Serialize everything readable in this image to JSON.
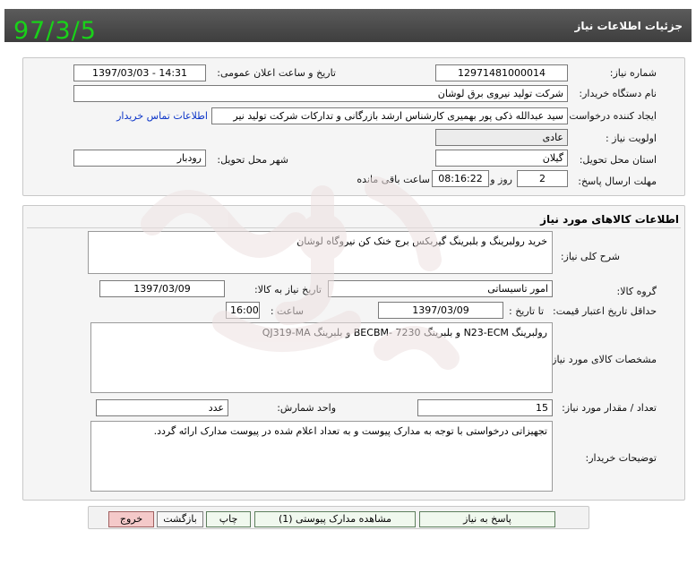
{
  "header": {
    "title": "جزئیات اطلاعات نیاز",
    "date_stamp": "97/3/5"
  },
  "need_info": {
    "need_number_label": "شماره نیاز:",
    "need_number": "12971481000014",
    "announce_label": "تاریخ و ساعت اعلان عمومی:",
    "announce_value": "1397/03/03 - 14:31",
    "buyer_org_label": "نام دستگاه خریدار:",
    "buyer_org": "شرکت تولید نیروی برق لوشان",
    "creator_label": "ایجاد کننده درخواست:",
    "creator": "سید عبدالله ذکی پور بهمیری کارشناس ارشد بازرگانی و تدارکات شرکت تولید نیر",
    "contact_link": "اطلاعات تماس خریدار",
    "priority_label": "اولویت نیاز :",
    "priority": "عادی",
    "province_label": "استان محل تحویل:",
    "province": "گیلان",
    "city_label": "شهر محل تحویل:",
    "city": "رودبار",
    "deadline_label": "مهلت ارسال پاسخ:",
    "days_value": "2",
    "days_word": "روز و",
    "time_value": "08:16:22",
    "remaining_word": "ساعت باقی مانده"
  },
  "goods": {
    "section_title": "اطلاعات کالاهای مورد نیاز",
    "summary_label": "شرح کلی نیاز:",
    "summary": "خرید رولبرینگ و بلبرینگ گیربکس برج خنک کن نیروگاه لوشان",
    "group_label": "گروه کالا:",
    "group": "امور تاسیساتی",
    "need_date_label": "تاریخ نیاز به کالا:",
    "need_date": "1397/03/09",
    "price_valid_label": "حداقل تاریخ اعتبار قیمت:",
    "until_label": "تا تاریخ :",
    "until_date": "1397/03/09",
    "hour_label": "ساعت :",
    "hour": "16:00",
    "specs_label": "مشخصات کالای مورد نیاز:",
    "specs": "رولبرینگ N23-ECM و بلبرینگ BECBM- 7230 و بلبرینگ QJ319-MA",
    "quantity_label": "تعداد / مقدار مورد نیاز:",
    "quantity": "15",
    "unit_label": "واحد شمارش:",
    "unit": "عدد",
    "notes_label": "توضیحات خریدار:",
    "notes": "تجهیزاتی درخواستی با توجه به مدارک پیوست و به تعداد اعلام شده در پیوست مدارک ارائه گردد."
  },
  "buttons": {
    "reply": "پاسخ به نیاز",
    "attachments": "مشاهده مدارک پیوستی (1)",
    "print": "چاپ",
    "back": "بازگشت",
    "exit": "خروج"
  },
  "colors": {
    "header_bg": "#4a4a4a",
    "stamp": "#19d219",
    "link": "#0b34c8",
    "exit_bg": "#f4c9c9"
  }
}
